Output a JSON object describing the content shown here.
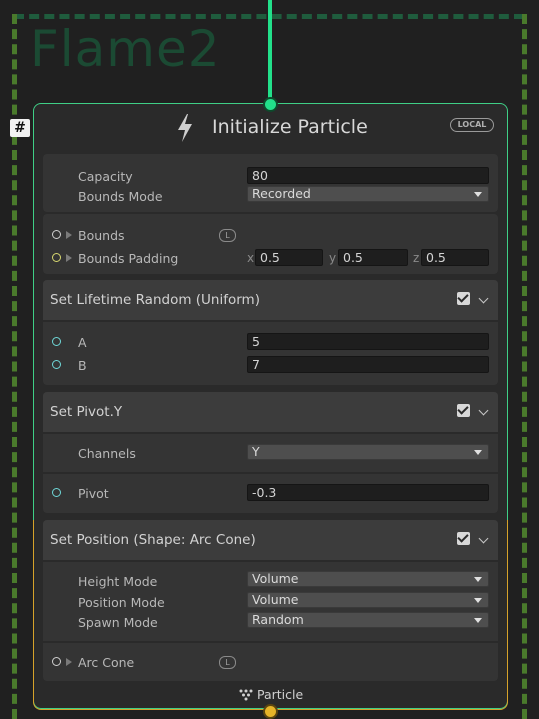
{
  "system": {
    "title": "Flame2"
  },
  "context": {
    "title": "Initialize Particle",
    "space_badge": "LOCAL",
    "capacity_label": "Capacity",
    "capacity_value": "80",
    "bounds_mode_label": "Bounds Mode",
    "bounds_mode_value": "Recorded",
    "bounds_label": "Bounds",
    "bounds_space": "L",
    "bounds_padding_label": "Bounds Padding",
    "bounds_padding": {
      "x_label": "x",
      "x": "0.5",
      "y_label": "y",
      "y": "0.5",
      "z_label": "z",
      "z": "0.5"
    },
    "output_label": "Particle",
    "badge": "#"
  },
  "blocks": {
    "lifetime": {
      "title": "Set Lifetime Random (Uniform)",
      "a_label": "A",
      "a_value": "5",
      "b_label": "B",
      "b_value": "7"
    },
    "pivot": {
      "title": "Set Pivot.Y",
      "channels_label": "Channels",
      "channels_value": "Y",
      "pivot_label": "Pivot",
      "pivot_value": "-0.3"
    },
    "position": {
      "title": "Set Position (Shape: Arc Cone)",
      "height_mode_label": "Height Mode",
      "height_mode_value": "Volume",
      "position_mode_label": "Position Mode",
      "position_mode_value": "Volume",
      "spawn_mode_label": "Spawn Mode",
      "spawn_mode_value": "Random",
      "arc_cone_label": "Arc Cone",
      "arc_cone_space": "L"
    }
  },
  "colors": {
    "flow_in": "#22e08a",
    "flow_out": "#e6b328",
    "port_float": "#6fd8d8",
    "port_vector": "#d8d870",
    "port_struct": "#d0d0d0"
  }
}
